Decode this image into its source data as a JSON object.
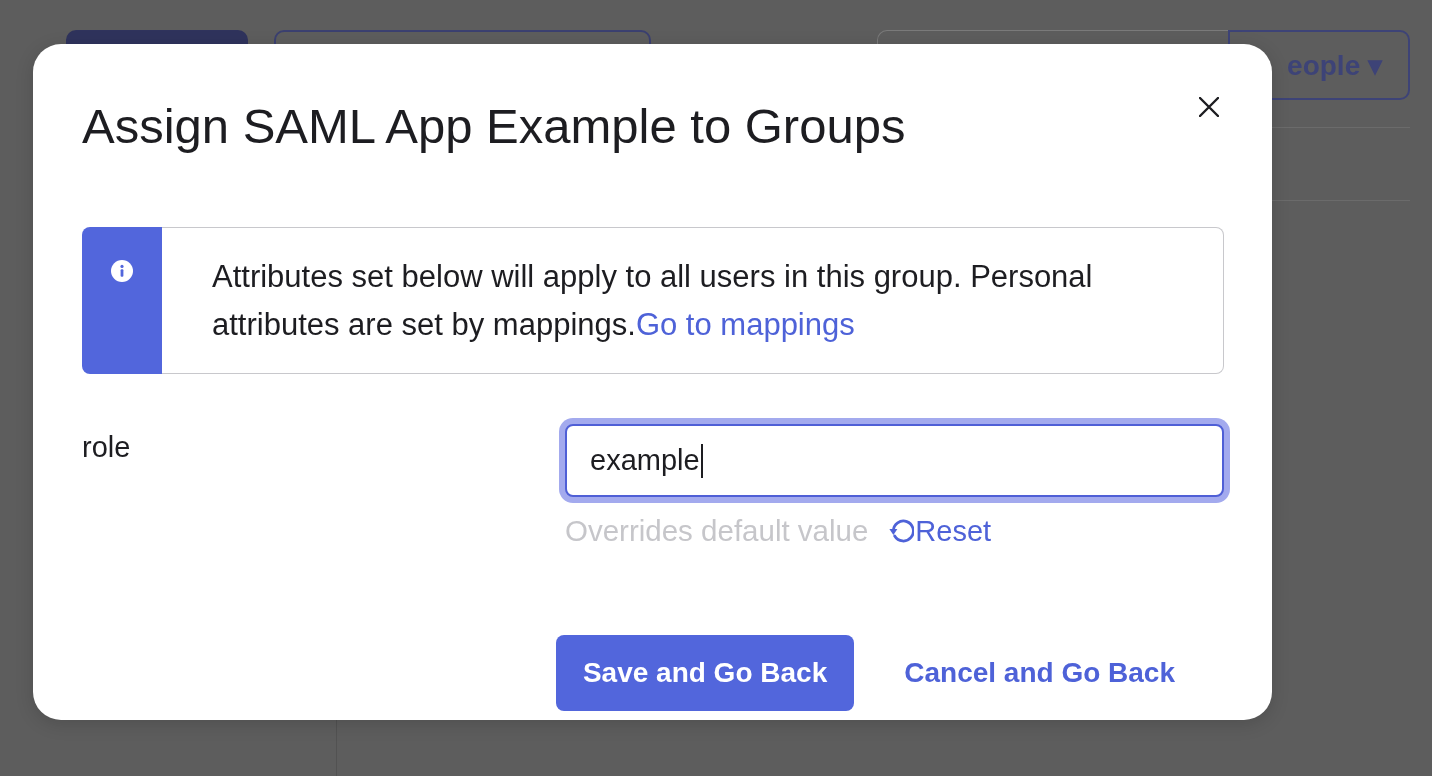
{
  "background": {
    "toolbar_dropdown": {
      "label": "eople",
      "caret": "▾"
    }
  },
  "dialog": {
    "title": "Assign SAML App Example to Groups",
    "notice": {
      "text": "Attributes set below will apply to all users in this group. Personal attributes are set by mappings.",
      "link": "Go to mappings"
    },
    "fields": [
      {
        "label": "role",
        "value": "example",
        "focused": true,
        "hint": "Overrides default value",
        "reset": "Reset"
      }
    ],
    "buttons": [
      {
        "label": "Save and Go Back",
        "kind": "primary"
      },
      {
        "label": "Cancel and Go Back",
        "kind": "link"
      }
    ]
  }
}
